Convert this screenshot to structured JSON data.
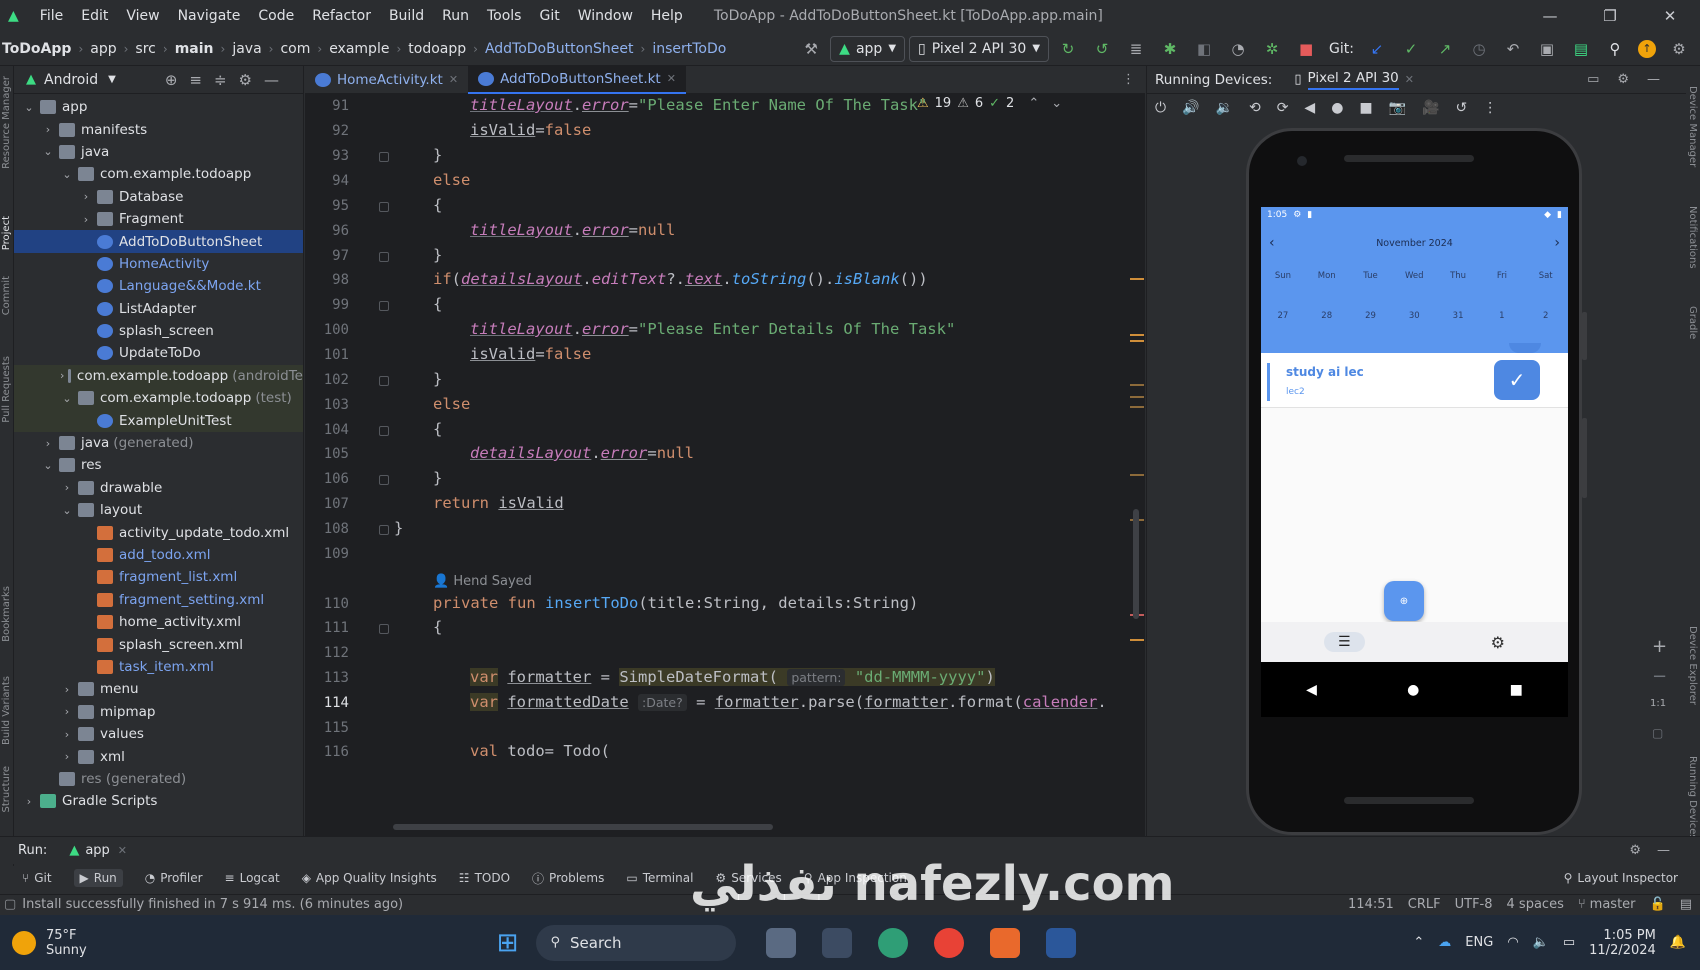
{
  "menu": [
    "File",
    "Edit",
    "View",
    "Navigate",
    "Code",
    "Refactor",
    "Build",
    "Run",
    "Tools",
    "Git",
    "Window",
    "Help"
  ],
  "window_title": "ToDoApp - AddToDoButtonSheet.kt [ToDoApp.app.main]",
  "breadcrumb": [
    "ToDoApp",
    "app",
    "src",
    "main",
    "java",
    "com",
    "example",
    "todoapp",
    "AddToDoButtonSheet",
    "insertToDo"
  ],
  "run_config": "app",
  "device_selector": "Pixel 2 API 30",
  "git_label": "Git:",
  "project": {
    "view_label": "Android",
    "tree": [
      {
        "label": "app",
        "depth": 0,
        "type": "folder",
        "expanded": true
      },
      {
        "label": "manifests",
        "depth": 1,
        "type": "folder",
        "expanded": false
      },
      {
        "label": "java",
        "depth": 1,
        "type": "folder",
        "expanded": true
      },
      {
        "label": "com.example.todoapp",
        "depth": 2,
        "type": "folder",
        "expanded": true
      },
      {
        "label": "Database",
        "depth": 3,
        "type": "folder",
        "expanded": false
      },
      {
        "label": "Fragment",
        "depth": 3,
        "type": "folder",
        "expanded": false
      },
      {
        "label": "AddToDoButtonSheet",
        "depth": 3,
        "type": "kt",
        "selected": true
      },
      {
        "label": "HomeActivity",
        "depth": 3,
        "type": "kt",
        "color": "blue"
      },
      {
        "label": "Language&&Mode.kt",
        "depth": 3,
        "type": "kt",
        "color": "blue"
      },
      {
        "label": "ListAdapter",
        "depth": 3,
        "type": "kt"
      },
      {
        "label": "splash_screen",
        "depth": 3,
        "type": "kt"
      },
      {
        "label": "UpdateToDo",
        "depth": 3,
        "type": "kt"
      },
      {
        "label": "com.example.todoapp",
        "suffix": "(androidTe",
        "depth": 2,
        "type": "folder",
        "expanded": false,
        "hl": true
      },
      {
        "label": "com.example.todoapp",
        "suffix": "(test)",
        "depth": 2,
        "type": "folder",
        "expanded": true,
        "hl": true
      },
      {
        "label": "ExampleUnitTest",
        "depth": 3,
        "type": "kt",
        "hl": true
      },
      {
        "label": "java",
        "suffix": "(generated)",
        "depth": 1,
        "type": "folder",
        "expanded": false
      },
      {
        "label": "res",
        "depth": 1,
        "type": "folder",
        "expanded": true
      },
      {
        "label": "drawable",
        "depth": 2,
        "type": "folder",
        "expanded": false
      },
      {
        "label": "layout",
        "depth": 2,
        "type": "folder",
        "expanded": true
      },
      {
        "label": "activity_update_todo.xml",
        "depth": 3,
        "type": "xml"
      },
      {
        "label": "add_todo.xml",
        "depth": 3,
        "type": "xml",
        "color": "blue"
      },
      {
        "label": "fragment_list.xml",
        "depth": 3,
        "type": "xml",
        "color": "blue"
      },
      {
        "label": "fragment_setting.xml",
        "depth": 3,
        "type": "xml",
        "color": "blue"
      },
      {
        "label": "home_activity.xml",
        "depth": 3,
        "type": "xml"
      },
      {
        "label": "splash_screen.xml",
        "depth": 3,
        "type": "xml"
      },
      {
        "label": "task_item.xml",
        "depth": 3,
        "type": "xml",
        "color": "blue"
      },
      {
        "label": "menu",
        "depth": 2,
        "type": "folder",
        "expanded": false
      },
      {
        "label": "mipmap",
        "depth": 2,
        "type": "folder",
        "expanded": false
      },
      {
        "label": "values",
        "depth": 2,
        "type": "folder",
        "expanded": false
      },
      {
        "label": "xml",
        "depth": 2,
        "type": "folder",
        "expanded": false
      },
      {
        "label": "res (generated)",
        "depth": 1,
        "type": "folder",
        "muted": true
      },
      {
        "label": "Gradle Scripts",
        "depth": 0,
        "type": "gradle",
        "expanded": false
      }
    ]
  },
  "tabs": [
    {
      "label": "HomeActivity.kt",
      "active": false
    },
    {
      "label": "AddToDoButtonSheet.kt",
      "active": true
    }
  ],
  "inspections": {
    "errors": "19",
    "warnings": "6",
    "ok": "2"
  },
  "code": {
    "line_numbers": [
      "91",
      "92",
      "93",
      "94",
      "95",
      "96",
      "97",
      "98",
      "99",
      "100",
      "101",
      "102",
      "103",
      "104",
      "105",
      "106",
      "107",
      "108",
      "109",
      "",
      "110",
      "111",
      "112",
      "113",
      "114",
      "115",
      "116"
    ],
    "author": "Hend Sayed",
    "l91_str": "\"Please Enter Name Of The Task\"",
    "l100_str": "\"Please Enter Details Of The Task\"",
    "l113_hint": "pattern:",
    "l113_pattern": "\"dd-MMMM-yyyy\"",
    "l114_hint": ":Date?"
  },
  "running_devices": {
    "title": "Running Devices:",
    "device_tab": "Pixel 2 API 30"
  },
  "phone": {
    "status_time": "1:05",
    "month": "November 2024",
    "weekdays": [
      "Sun",
      "Mon",
      "Tue",
      "Wed",
      "Thu",
      "Fri",
      "Sat"
    ],
    "dates": [
      "27",
      "28",
      "29",
      "30",
      "31",
      "1",
      "2"
    ],
    "task_title": "study ai lec",
    "task_details": "lec2"
  },
  "bottom": {
    "run_label": "Run:",
    "run_config": "app",
    "tools": [
      "Git",
      "Run",
      "Profiler",
      "Logcat",
      "App Quality Insights",
      "TODO",
      "Problems",
      "Terminal",
      "Services",
      "App Inspection"
    ],
    "layout_inspector": "Layout Inspector"
  },
  "status": {
    "message": "Install successfully finished in 7 s 914 ms. (6 minutes ago)",
    "position": "114:51",
    "line_sep": "CRLF",
    "encoding": "UTF-8",
    "indent": "4 spaces",
    "branch": "master"
  },
  "taskbar": {
    "temp": "75°F",
    "weather": "Sunny",
    "search": "Search",
    "lang": "ENG",
    "time": "1:05 PM",
    "date": "11/2/2024"
  },
  "watermark": "نفذلي nafezly.com",
  "colors": {
    "accent": "#3574f0",
    "phone_header": "#5b96ee",
    "task_accent": "#5b96ee"
  }
}
